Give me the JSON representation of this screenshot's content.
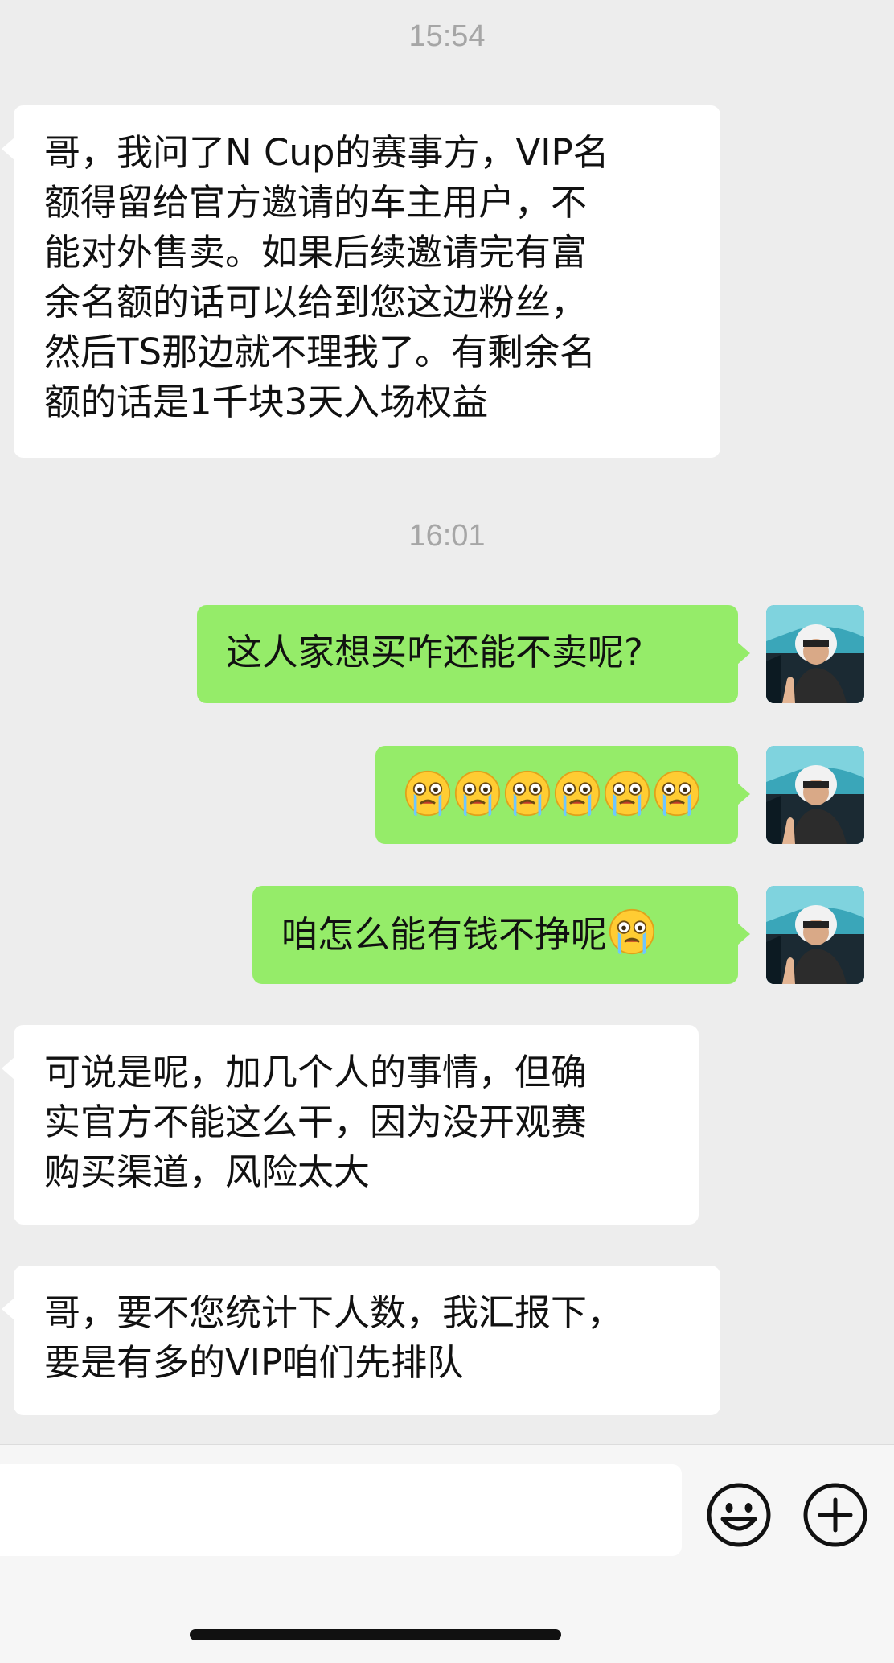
{
  "chat": {
    "timestamps": [
      "15:54",
      "16:01"
    ],
    "messages": [
      {
        "side": "in",
        "text": "哥，我问了N Cup的赛事方，VIP名\n额得留给官方邀请的车主用户，不\n能对外售卖。如果后续邀请完有富\n余名额的话可以给到您这边粉丝，\n然后TS那边就不理我了。有剩余名\n额的话是1千块3天入场权益"
      },
      {
        "side": "out",
        "text": "这人家想买咋还能不卖呢?"
      },
      {
        "side": "out",
        "text": "",
        "emoji": [
          "crying-face",
          "crying-face",
          "crying-face",
          "crying-face",
          "crying-face",
          "crying-face"
        ]
      },
      {
        "side": "out",
        "text": "咱怎么能有钱不挣呢",
        "emoji": [
          "crying-face"
        ]
      },
      {
        "side": "in",
        "text": "可说是呢，加几个人的事情，但确\n实官方不能这么干，因为没开观赛\n购买渠道，风险太大"
      },
      {
        "side": "in",
        "text": "哥，要不您统计下人数，我汇报下，\n要是有多的VIP咱们先排队"
      }
    ]
  },
  "input_bar": {
    "input_value": "",
    "emoji_button_icon": "smiley-face-icon",
    "plus_button_icon": "plus-circle-icon"
  },
  "colors": {
    "background": "#ededed",
    "incoming_bubble": "#ffffff",
    "outgoing_bubble": "#95ec69",
    "timestamp": "#a6a6a6"
  }
}
